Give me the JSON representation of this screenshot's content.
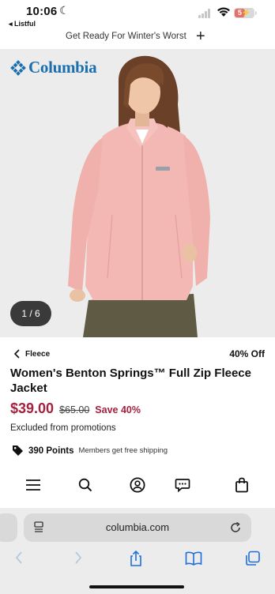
{
  "status_bar": {
    "time": "10:06",
    "back_app": "Listful",
    "battery": "5"
  },
  "promo": {
    "text": "Get Ready For Winter's Worst"
  },
  "brand": {
    "name": "Columbia",
    "color": "#1b6fae"
  },
  "gallery": {
    "counter": "1 / 6"
  },
  "product": {
    "breadcrumb": "Fleece",
    "discount": "40% Off",
    "title": "Women's Benton Springs™ Full Zip Fleece Jacket",
    "price": "$39.00",
    "original_price": "$65.00",
    "savings": "Save 40%",
    "excluded_note": "Excluded from promotions",
    "points": "390 Points",
    "shipping_note": "Members get free shipping",
    "price_color": "#a4203f"
  },
  "nav_icons": [
    "menu-icon",
    "search-icon",
    "account-icon",
    "chat-icon",
    "bag-icon"
  ],
  "browser": {
    "url": "columbia.com"
  }
}
